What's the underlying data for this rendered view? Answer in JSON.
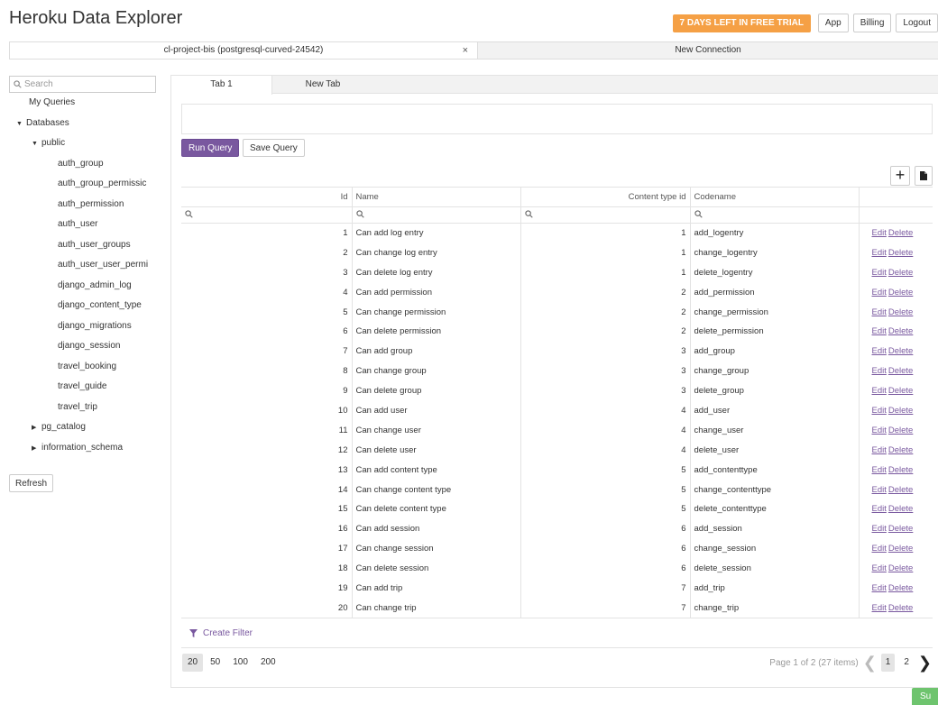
{
  "app": {
    "title": "Heroku Data Explorer",
    "trial_badge": "7 DAYS LEFT IN FREE TRIAL",
    "header_buttons": [
      "App",
      "Billing",
      "Logout"
    ]
  },
  "connection_tabs": [
    {
      "label": "cl-project-bis (postgresql-curved-24542)",
      "close": "×"
    },
    {
      "label": "New Connection"
    }
  ],
  "sidebar": {
    "search_placeholder": "Search",
    "my_queries": "My Queries",
    "databases": "Databases",
    "schema_public": "public",
    "tables": [
      "auth_group",
      "auth_group_permissic",
      "auth_permission",
      "auth_user",
      "auth_user_groups",
      "auth_user_user_permi",
      "django_admin_log",
      "django_content_type",
      "django_migrations",
      "django_session",
      "travel_booking",
      "travel_guide",
      "travel_trip"
    ],
    "other_schemas": [
      "pg_catalog",
      "information_schema"
    ],
    "refresh": "Refresh"
  },
  "query_tabs": [
    "Tab 1",
    "New Tab"
  ],
  "query": {
    "text": "",
    "run": "Run Query",
    "save": "Save Query",
    "add": "+"
  },
  "table": {
    "columns": [
      "Id",
      "Name",
      "Content type id",
      "Codename"
    ],
    "edit": "Edit",
    "delete": "Delete",
    "rows": [
      {
        "id": "1",
        "name": "Can add log entry",
        "content_type_id": "1",
        "codename": "add_logentry"
      },
      {
        "id": "2",
        "name": "Can change log entry",
        "content_type_id": "1",
        "codename": "change_logentry"
      },
      {
        "id": "3",
        "name": "Can delete log entry",
        "content_type_id": "1",
        "codename": "delete_logentry"
      },
      {
        "id": "4",
        "name": "Can add permission",
        "content_type_id": "2",
        "codename": "add_permission"
      },
      {
        "id": "5",
        "name": "Can change permission",
        "content_type_id": "2",
        "codename": "change_permission"
      },
      {
        "id": "6",
        "name": "Can delete permission",
        "content_type_id": "2",
        "codename": "delete_permission"
      },
      {
        "id": "7",
        "name": "Can add group",
        "content_type_id": "3",
        "codename": "add_group"
      },
      {
        "id": "8",
        "name": "Can change group",
        "content_type_id": "3",
        "codename": "change_group"
      },
      {
        "id": "9",
        "name": "Can delete group",
        "content_type_id": "3",
        "codename": "delete_group"
      },
      {
        "id": "10",
        "name": "Can add user",
        "content_type_id": "4",
        "codename": "add_user"
      },
      {
        "id": "11",
        "name": "Can change user",
        "content_type_id": "4",
        "codename": "change_user"
      },
      {
        "id": "12",
        "name": "Can delete user",
        "content_type_id": "4",
        "codename": "delete_user"
      },
      {
        "id": "13",
        "name": "Can add content type",
        "content_type_id": "5",
        "codename": "add_contenttype"
      },
      {
        "id": "14",
        "name": "Can change content type",
        "content_type_id": "5",
        "codename": "change_contenttype"
      },
      {
        "id": "15",
        "name": "Can delete content type",
        "content_type_id": "5",
        "codename": "delete_contenttype"
      },
      {
        "id": "16",
        "name": "Can add session",
        "content_type_id": "6",
        "codename": "add_session"
      },
      {
        "id": "17",
        "name": "Can change session",
        "content_type_id": "6",
        "codename": "change_session"
      },
      {
        "id": "18",
        "name": "Can delete session",
        "content_type_id": "6",
        "codename": "delete_session"
      },
      {
        "id": "19",
        "name": "Can add trip",
        "content_type_id": "7",
        "codename": "add_trip"
      },
      {
        "id": "20",
        "name": "Can change trip",
        "content_type_id": "7",
        "codename": "change_trip"
      }
    ]
  },
  "footer": {
    "create_filter": "Create Filter",
    "page_sizes": [
      "20",
      "50",
      "100",
      "200"
    ],
    "page_info": "Page 1 of 2 (27 items)",
    "pages": [
      "1",
      "2"
    ]
  },
  "support": {
    "label": "Su"
  },
  "colors": {
    "accent": "#79589f",
    "trial": "#f5a045",
    "support": "#6ec46e"
  }
}
